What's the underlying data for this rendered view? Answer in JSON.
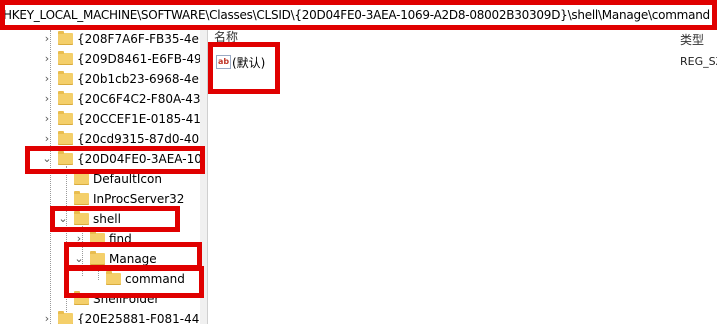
{
  "address_bar": {
    "path": "HKEY_LOCAL_MACHINE\\SOFTWARE\\Classes\\CLSID\\{20D04FE0-3AEA-1069-A2D8-08002B30309D}\\shell\\Manage\\command"
  },
  "tree": {
    "items": [
      {
        "label": "{208F7A6F-FB35-4e",
        "expanded": false
      },
      {
        "label": "{209D8461-E6FB-49",
        "expanded": false
      },
      {
        "label": "{20b1cb23-6968-4e",
        "expanded": false
      },
      {
        "label": "{20C6F4C2-F80A-43",
        "expanded": false
      },
      {
        "label": "{20CCEF1E-0185-41",
        "expanded": false
      },
      {
        "label": "{20cd9315-87d0-40",
        "expanded": false
      },
      {
        "label": "{20D04FE0-3AEA-10",
        "expanded": true
      },
      {
        "label": "DefaultIcon",
        "expanded": false
      },
      {
        "label": "InProcServer32",
        "expanded": false
      },
      {
        "label": "shell",
        "expanded": true
      },
      {
        "label": "find",
        "expanded": false
      },
      {
        "label": "Manage",
        "expanded": true
      },
      {
        "label": "command",
        "expanded": false
      },
      {
        "label": "ShellFolder",
        "expanded": false
      },
      {
        "label": "{20E25881-F081-44",
        "expanded": false
      }
    ]
  },
  "values_pane": {
    "columns": {
      "name": "名称",
      "type": "类型"
    },
    "rows": [
      {
        "name": "(默认)",
        "type": "REG_SZ",
        "icon": "string-value-icon"
      }
    ]
  },
  "colors": {
    "highlight": "#e00000",
    "folder": "#f4cf6a"
  }
}
